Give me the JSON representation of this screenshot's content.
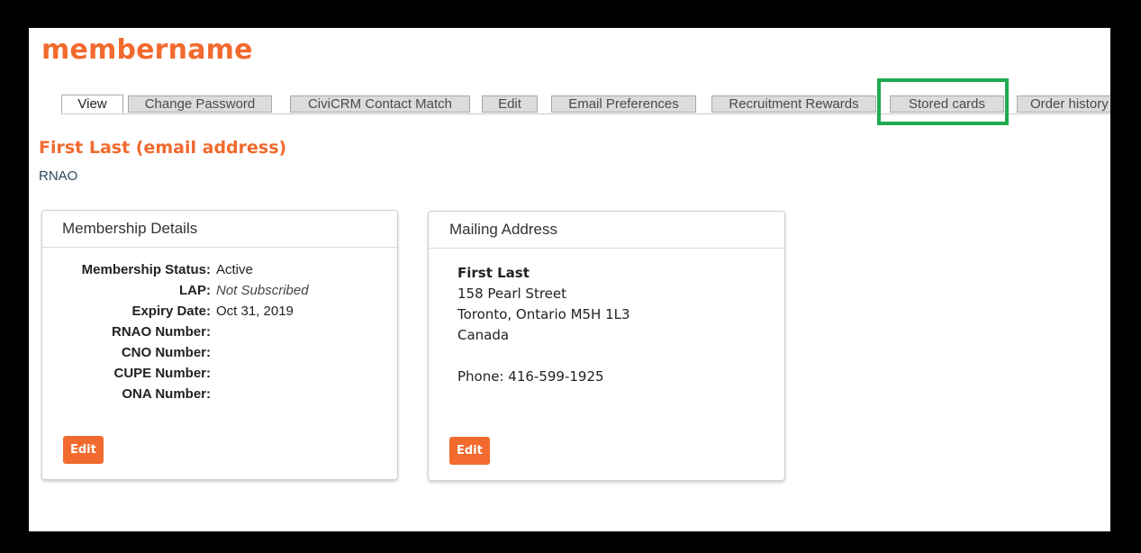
{
  "site": {
    "title": "membername"
  },
  "tabs": [
    {
      "label": "View",
      "active": true
    },
    {
      "label": "Change Password",
      "active": false
    },
    {
      "label": "CiviCRM Contact Match",
      "active": false
    },
    {
      "label": "Edit",
      "active": false
    },
    {
      "label": "Email Preferences",
      "active": false
    },
    {
      "label": "Recruitment Rewards",
      "active": false
    },
    {
      "label": "Stored cards",
      "active": false,
      "highlighted": true
    },
    {
      "label": "Order history",
      "active": false
    }
  ],
  "colors": {
    "accent": "#f26a2e",
    "highlight": "#1eab4f",
    "link": "#2c4a5e"
  },
  "contact": {
    "heading": "First Last (email address)",
    "organization": "RNAO"
  },
  "membership": {
    "title": "Membership Details",
    "rows": [
      {
        "label": "Membership Status:",
        "value": "Active"
      },
      {
        "label": "LAP:",
        "value": "Not Subscribed"
      },
      {
        "label": "Expiry Date:",
        "value": "Oct 31, 2019"
      },
      {
        "label": "RNAO Number:",
        "value": ""
      },
      {
        "label": "CNO Number:",
        "value": ""
      },
      {
        "label": "CUPE Number:",
        "value": ""
      },
      {
        "label": "ONA Number:",
        "value": ""
      }
    ],
    "edit_label": "Edit"
  },
  "mailing": {
    "title": "Mailing Address",
    "name": "First Last",
    "street": "158 Pearl Street",
    "city_line": "Toronto, Ontario M5H 1L3",
    "country": "Canada",
    "phone": "Phone: 416-599-1925",
    "edit_label": "Edit"
  }
}
